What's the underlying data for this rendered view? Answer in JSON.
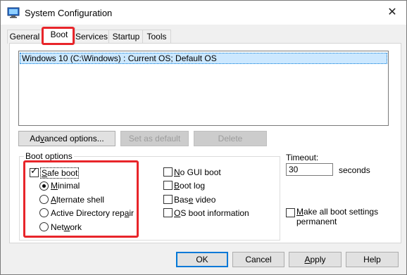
{
  "window": {
    "title": "System Configuration",
    "close_glyph": "✕"
  },
  "tabs": [
    {
      "label": "General"
    },
    {
      "label": "Boot"
    },
    {
      "label": "Services"
    },
    {
      "label": "Startup"
    },
    {
      "label": "Tools"
    }
  ],
  "os_list": [
    "Windows 10 (C:\\Windows) : Current OS; Default OS"
  ],
  "list_buttons": {
    "advanced": {
      "pre": "Ad",
      "acc": "v",
      "post": "anced options..."
    },
    "set_default": {
      "label": "Set as default"
    },
    "delete": {
      "label": "Delete"
    }
  },
  "boot_options": {
    "label": "Boot options",
    "safe_boot": {
      "pre": "",
      "acc": "S",
      "post": "afe boot",
      "checked": true
    },
    "radios": [
      {
        "pre": "",
        "acc": "M",
        "post": "inimal",
        "selected": true
      },
      {
        "pre": "",
        "acc": "A",
        "post": "lternate shell",
        "selected": false
      },
      {
        "pre": "Active Directory rep",
        "acc": "a",
        "post": "ir",
        "selected": false
      },
      {
        "pre": "Net",
        "acc": "w",
        "post": "ork",
        "selected": false
      }
    ],
    "right": [
      {
        "pre": "",
        "acc": "N",
        "post": "o GUI boot",
        "checked": false
      },
      {
        "pre": "",
        "acc": "B",
        "post": "oot log",
        "checked": false
      },
      {
        "pre": "Bas",
        "acc": "e",
        "post": " video",
        "checked": false
      },
      {
        "pre": "",
        "acc": "O",
        "post": "S boot information",
        "checked": false
      }
    ]
  },
  "timeout": {
    "label": "Timeout:",
    "value": "30",
    "unit": "seconds"
  },
  "permanent": {
    "pre": "",
    "acc": "M",
    "post": "ake all boot settings",
    "line2": "permanent",
    "checked": false
  },
  "footer": {
    "ok": "OK",
    "cancel": "Cancel",
    "apply": {
      "pre": "",
      "acc": "A",
      "post": "pply"
    },
    "help": "Help"
  },
  "colors": {
    "highlight": "#e8252a",
    "selection": "#cce8ff",
    "focus": "#0078d7"
  },
  "icons": {
    "app": "system-configuration-icon",
    "close": "close-icon"
  }
}
